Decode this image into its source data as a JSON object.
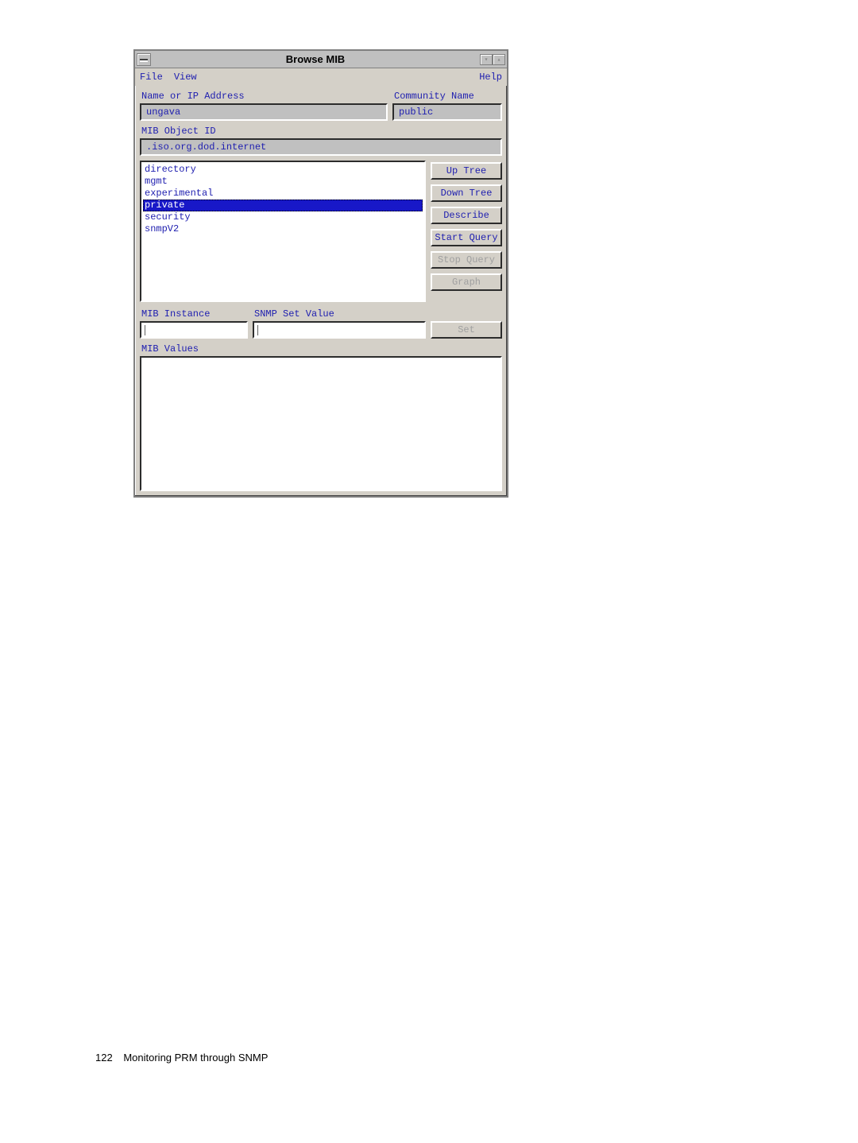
{
  "window": {
    "title": "Browse MIB"
  },
  "menubar": {
    "file": "File",
    "view": "View",
    "help": "Help"
  },
  "labels": {
    "name_or_ip": "Name or IP Address",
    "community": "Community Name",
    "mib_object_id": "MIB Object ID",
    "mib_instance": "MIB Instance",
    "snmp_set_value": "SNMP Set Value",
    "mib_values": "MIB Values"
  },
  "fields": {
    "name_or_ip": "ungava",
    "community": "public",
    "mib_object_id": ".iso.org.dod.internet",
    "mib_instance": "",
    "snmp_set_value": ""
  },
  "tree": {
    "items": [
      "directory",
      "mgmt",
      "experimental",
      "private",
      "security",
      "snmpV2"
    ],
    "selected_index": 3
  },
  "buttons": {
    "up_tree": "Up Tree",
    "down_tree": "Down Tree",
    "describe": "Describe",
    "start_query": "Start Query",
    "stop_query": "Stop Query",
    "graph": "Graph",
    "set": "Set"
  },
  "button_enabled": {
    "up_tree": true,
    "down_tree": true,
    "describe": true,
    "start_query": true,
    "stop_query": false,
    "graph": false,
    "set": false
  },
  "footer": {
    "page_number": "122",
    "chapter": "Monitoring PRM through SNMP"
  }
}
